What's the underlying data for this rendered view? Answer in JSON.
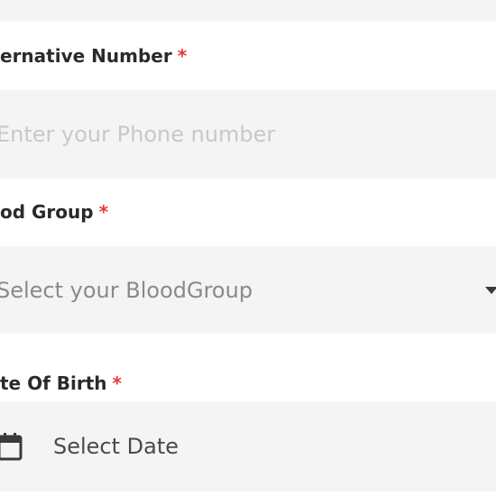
{
  "form": {
    "alternative_number": {
      "label": "ernative Number",
      "required_mark": "*",
      "placeholder": "Enter your Phone number"
    },
    "blood_group": {
      "label": "od Group",
      "required_mark": "*",
      "placeholder": "Select your BloodGroup",
      "icon": "chevron-down-icon"
    },
    "date_of_birth": {
      "label": "te Of Birth",
      "required_mark": "*",
      "placeholder": "Select Date",
      "icon": "calendar-icon"
    }
  },
  "colors": {
    "required": "#e53935",
    "field_bg": "#f4f4f4",
    "label": "#2a2a2a"
  }
}
